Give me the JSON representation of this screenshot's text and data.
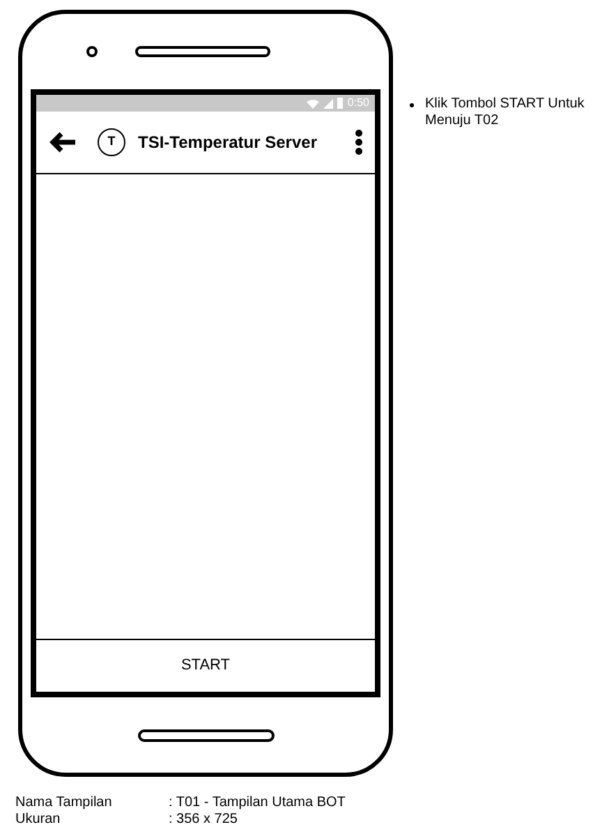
{
  "status_bar": {
    "time": "0:50"
  },
  "app_bar": {
    "title": "TSI-Temperatur Server",
    "avatar": "T"
  },
  "bottom_button": {
    "label": "START"
  },
  "notes": [
    "Klik Tombol START Untuk Menuju T02"
  ],
  "info": [
    {
      "label": "Nama Tampilan",
      "value": ": T01 - Tampilan Utama BOT"
    },
    {
      "label": "Ukuran",
      "value": ": 356 x 725"
    }
  ]
}
